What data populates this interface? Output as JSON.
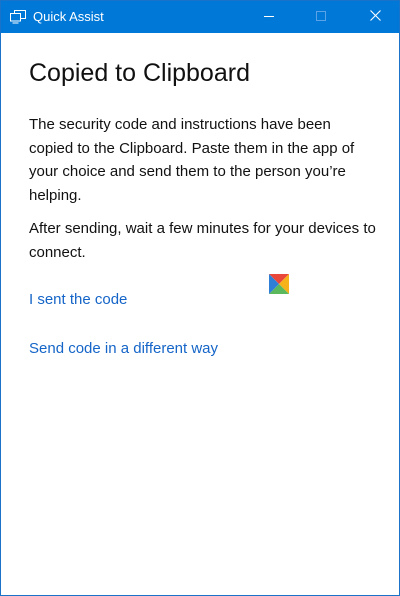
{
  "window": {
    "title": "Quick Assist",
    "accent_color": "#0078d7",
    "controls": {
      "minimize_icon": "minimize-icon",
      "maximize_icon": "maximize-icon",
      "close_icon": "close-icon"
    }
  },
  "main": {
    "heading": "Copied to Clipboard",
    "paragraph_1": "The security code and instructions have been copied to the Clipboard. Paste them in the app of your choice and send them to the person you’re helping.",
    "paragraph_2": "After sending, wait a few minutes for your devices to connect.",
    "links": {
      "sent_code": "I sent the code",
      "different_way": "Send code in a different way"
    },
    "link_color": "#1565c8"
  }
}
